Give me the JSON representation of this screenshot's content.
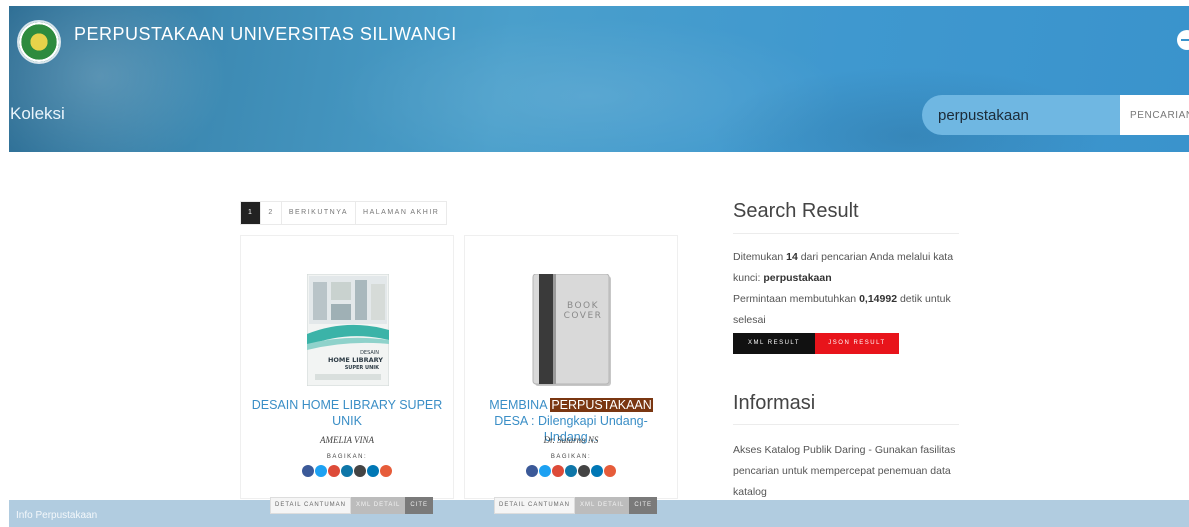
{
  "header": {
    "site_title": "PERPUSTAKAAN UNIVERSITAS SILIWANGI",
    "page_heading": "Koleksi",
    "search": {
      "value": "perpustakaan",
      "button_label": "PENCARIAN"
    }
  },
  "pagination": {
    "pages": [
      "1",
      "2"
    ],
    "next_label": "BERIKUTNYA",
    "last_label": "HALAMAN AKHIR"
  },
  "books": [
    {
      "title": "DESAIN HOME LIBRARY SUPER UNIK",
      "author": "AMELIA VINA",
      "share_label": "BAGIKAN:",
      "cover_text_1": "DESAIN",
      "cover_text_2": "HOME LIBRARY",
      "cover_text_3": "SUPER UNIK",
      "actions": {
        "detail": "DETAIL CANTUMAN",
        "xml": "XML DETAIL",
        "cite": "CITE"
      }
    },
    {
      "title_pre": "MEMBINA ",
      "title_highlight": "PERPUSTAKAAN",
      "title_post": " DESA : Dilengkapi Undang-Undang...",
      "author": "Dr. Sutarno NS",
      "share_label": "BAGIKAN:",
      "cover_text_1": "BOOK",
      "cover_text_2": "COVER",
      "actions": {
        "detail": "DETAIL CANTUMAN",
        "xml": "XML DETAIL",
        "cite": "CITE"
      }
    }
  ],
  "social_colors": [
    "#3b5998",
    "#1da1f2",
    "#dd4b39",
    "#0e76a8",
    "#444444",
    "#0077b5",
    "#e65c3a"
  ],
  "sidebar": {
    "search_result": {
      "heading": "Search Result",
      "line1_pre": "Ditemukan ",
      "count": "14",
      "line1_post": " dari pencarian Anda melalui kata",
      "line2_pre": "kunci: ",
      "keyword": "perpustakaan",
      "line3_pre": "Permintaan membutuhkan ",
      "time": "0,14992",
      "line3_post": " detik untuk",
      "line4": "selesai",
      "xml_button": "XML RESULT",
      "json_button": "JSON RESULT"
    },
    "informasi": {
      "heading": "Informasi",
      "line1": "Akses Katalog Publik Daring - Gunakan fasilitas",
      "line2": "pencarian untuk mempercepat penemuan data",
      "line3": "katalog"
    }
  },
  "footer": {
    "label": "Info Perpustakaan"
  },
  "colors": {
    "header": "#3d93c8",
    "highlight": "#7a3611",
    "json_button": "#e8141b",
    "link": "#3a8ec6"
  }
}
